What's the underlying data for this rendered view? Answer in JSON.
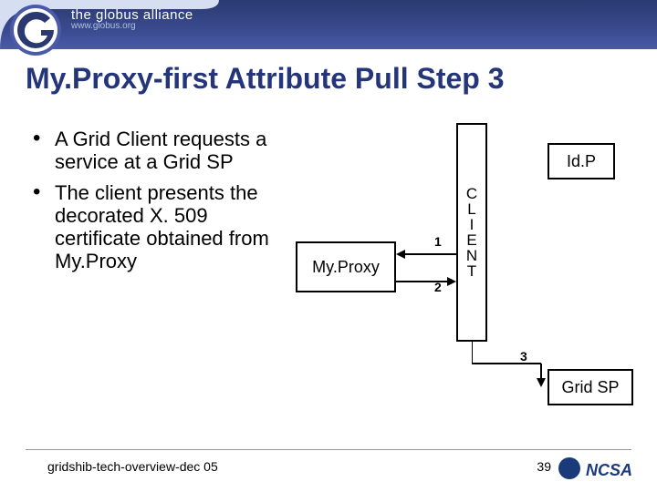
{
  "banner": {
    "org_line1": "the globus alliance",
    "org_line2": "www.globus.org"
  },
  "title": "My.Proxy-first Attribute Pull Step 3",
  "bullets": [
    "A Grid Client requests a service at a Grid SP",
    "The client presents the decorated X. 509 certificate obtained from My.Proxy"
  ],
  "diagram": {
    "myproxy": "My.Proxy",
    "client": "CLIENT",
    "idp": "Id.P",
    "gridsp": "Grid SP",
    "labels": {
      "l1": "1",
      "l2": "2",
      "l3": "3"
    }
  },
  "footer": {
    "left": "gridshib-tech-overview-dec 05",
    "page": "39",
    "ncsa": "NCSA"
  }
}
